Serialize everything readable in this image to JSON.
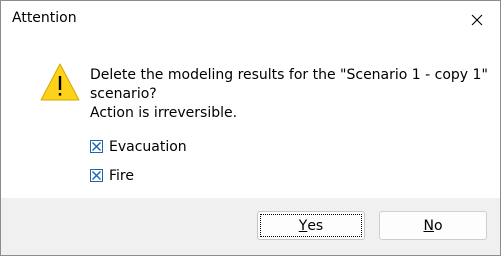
{
  "dialog": {
    "title": "Attention",
    "close_icon": "close-icon",
    "warning_icon": "warning-icon",
    "message_line1": "Delete the modeling results for the \"Scenario 1 - copy 1\"",
    "message_line2": "scenario?",
    "message_line3": "Action is irreversible.",
    "checkboxes": [
      {
        "label": "Evacuation",
        "checked": true
      },
      {
        "label": "Fire",
        "checked": true
      }
    ],
    "buttons": {
      "yes_mnemonic": "Y",
      "yes_rest": "es",
      "no_mnemonic": "N",
      "no_rest": "o"
    },
    "colors": {
      "warning_fill": "#ffd21a",
      "checkbox_accent": "#1e64b4",
      "footer_bg": "#f0f0f0"
    }
  }
}
